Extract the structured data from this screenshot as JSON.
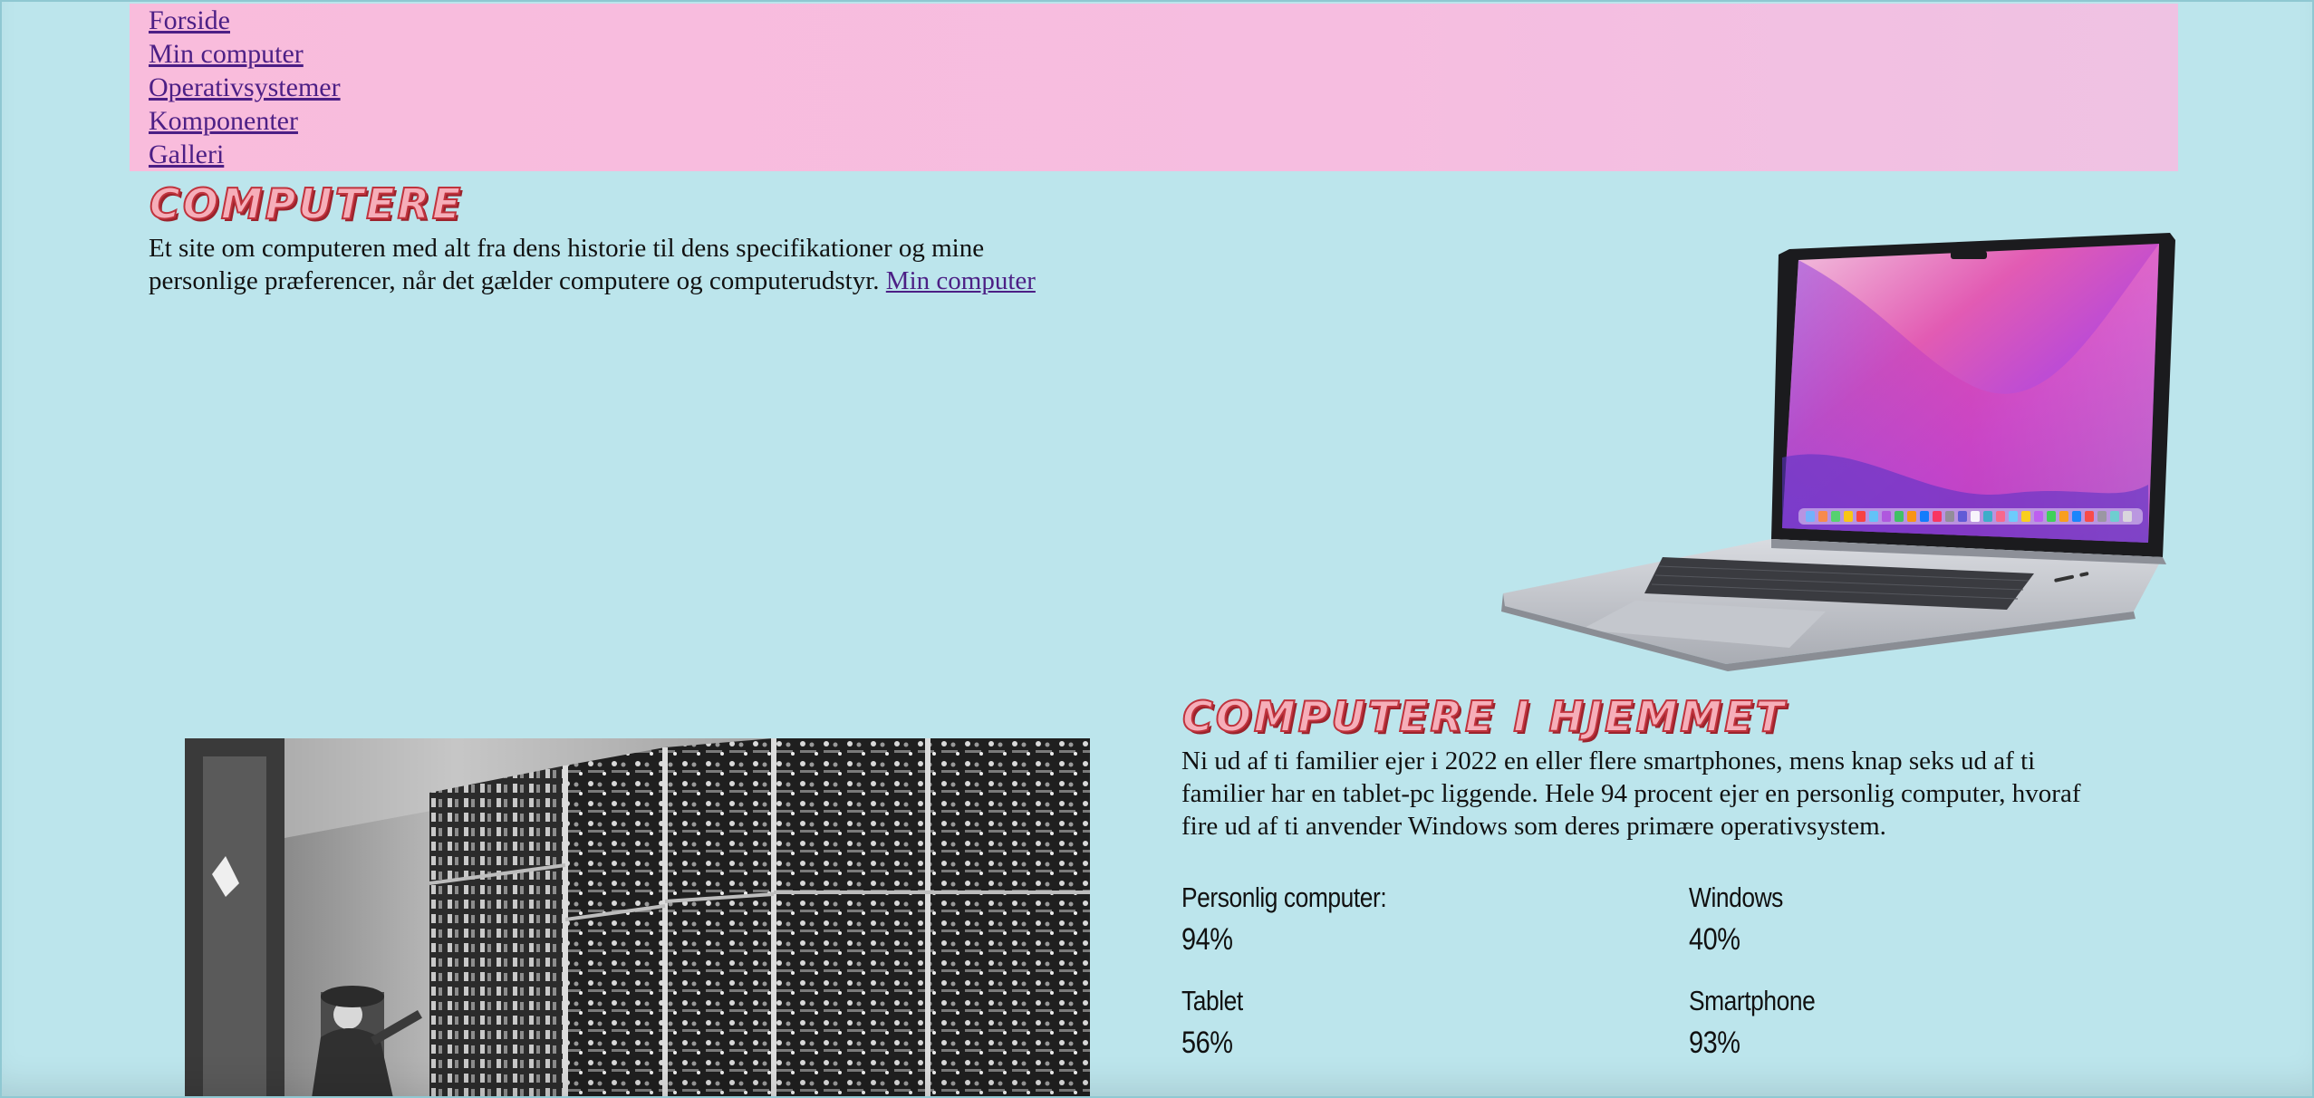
{
  "nav": {
    "items": [
      {
        "label": "Forside"
      },
      {
        "label": "Min computer"
      },
      {
        "label": "Operativsystemer"
      },
      {
        "label": "Komponenter"
      },
      {
        "label": "Galleri"
      }
    ]
  },
  "hero": {
    "title": "Computere",
    "text": "Et site om computeren med alt fra dens historie til dens specifikationer og mine personlige præferencer, når det gælder computere og computerudstyr.",
    "link_label": "Min computer"
  },
  "home": {
    "title": "Computere i hjemmet",
    "text": "Ni ud af ti familier ejer i 2022 en eller flere smartphones, mens knap seks ud af ti familier har en tablet-pc liggende. Hele 94 procent ejer en personlig computer, hvoraf fire ud af ti anvender Windows som deres primære operativsystem."
  },
  "stats": [
    {
      "label": "Personlig computer:",
      "value": "94%"
    },
    {
      "label": "Windows",
      "value": "40%"
    },
    {
      "label": "Tablet",
      "value": "56%"
    },
    {
      "label": "Smartphone",
      "value": "93%"
    }
  ],
  "colors": {
    "page_bg": "#bce5ec",
    "nav_bg": "#f9bcdc",
    "link": "#4c1f85",
    "title_fill": "#f6aeb9",
    "title_stroke": "#c0333d"
  }
}
